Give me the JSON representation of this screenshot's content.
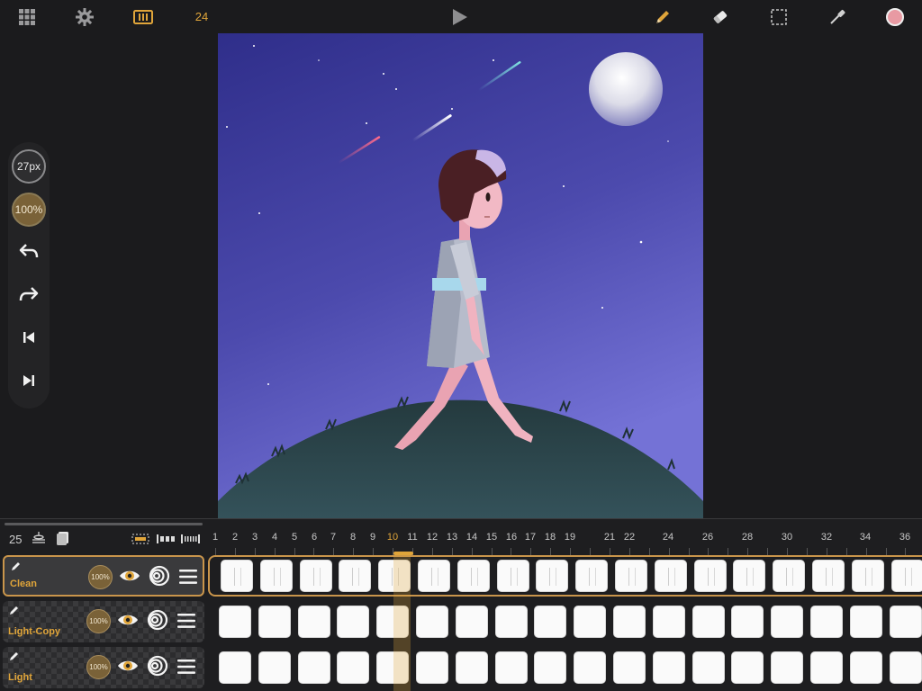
{
  "toolbar": {
    "fps": "24",
    "icons": [
      "grid-icon",
      "gear-icon",
      "film-icon",
      "play-icon",
      "pencil-icon",
      "eraser-icon",
      "selection-icon",
      "eyedropper-icon",
      "color-swatch"
    ],
    "color_swatch": "#e89aa3"
  },
  "palette": {
    "brush_size": "27px",
    "opacity": "100%"
  },
  "timeline": {
    "fps": "25",
    "current_frame": "10",
    "ruler": [
      "1",
      "2",
      "3",
      "4",
      "5",
      "6",
      "7",
      "8",
      "9",
      "10",
      "11",
      "12",
      "13",
      "14",
      "15",
      "16",
      "17",
      "18",
      "19",
      "21",
      "22",
      "24",
      "26",
      "28",
      "30",
      "32",
      "34",
      "36"
    ],
    "layers": [
      {
        "name": "Clean",
        "opacity": "100%",
        "active": true
      },
      {
        "name": "Light-Copy",
        "opacity": "100%",
        "active": false
      },
      {
        "name": "Light",
        "opacity": "100%",
        "active": false
      }
    ]
  },
  "colors": {
    "accent": "#e0a53a",
    "background": "#1b1b1d",
    "sky_top": "#2f2e8a",
    "sky_bottom": "#6d6bd0",
    "hill": "#2a4248"
  }
}
